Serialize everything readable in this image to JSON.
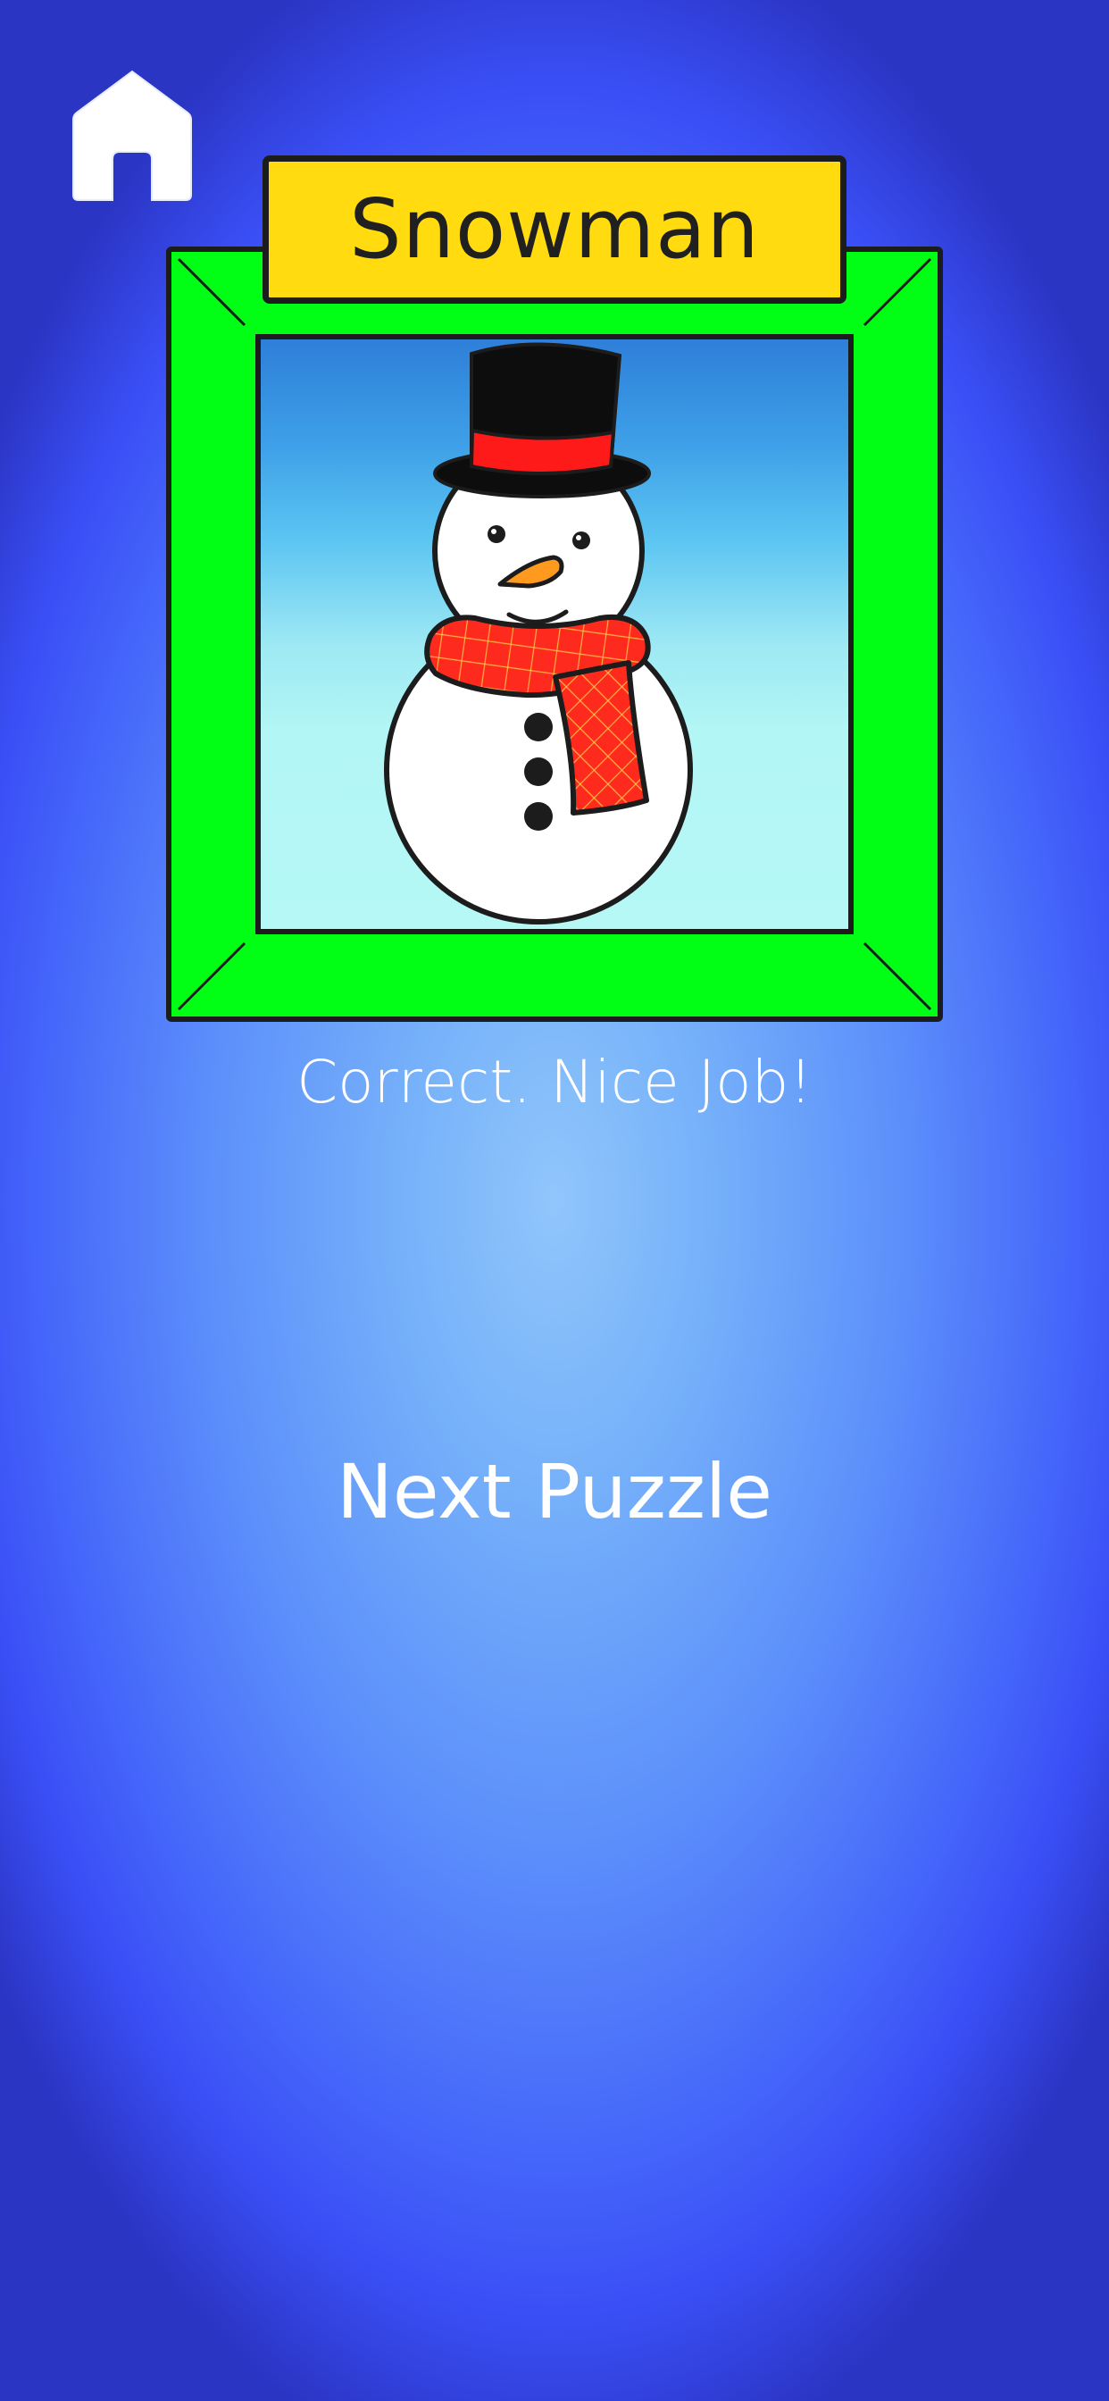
{
  "puzzle": {
    "title": "Snowman",
    "feedback": "Correct. Nice Job!",
    "next_label": "Next Puzzle"
  },
  "icons": {
    "home": "home-icon"
  },
  "colors": {
    "frame": "#00ff14",
    "title_plate": "#ffdb0f",
    "scarf": "#ff2a1e",
    "hat_band": "#ff1a1a",
    "carrot_nose": "#ff9a1e"
  }
}
